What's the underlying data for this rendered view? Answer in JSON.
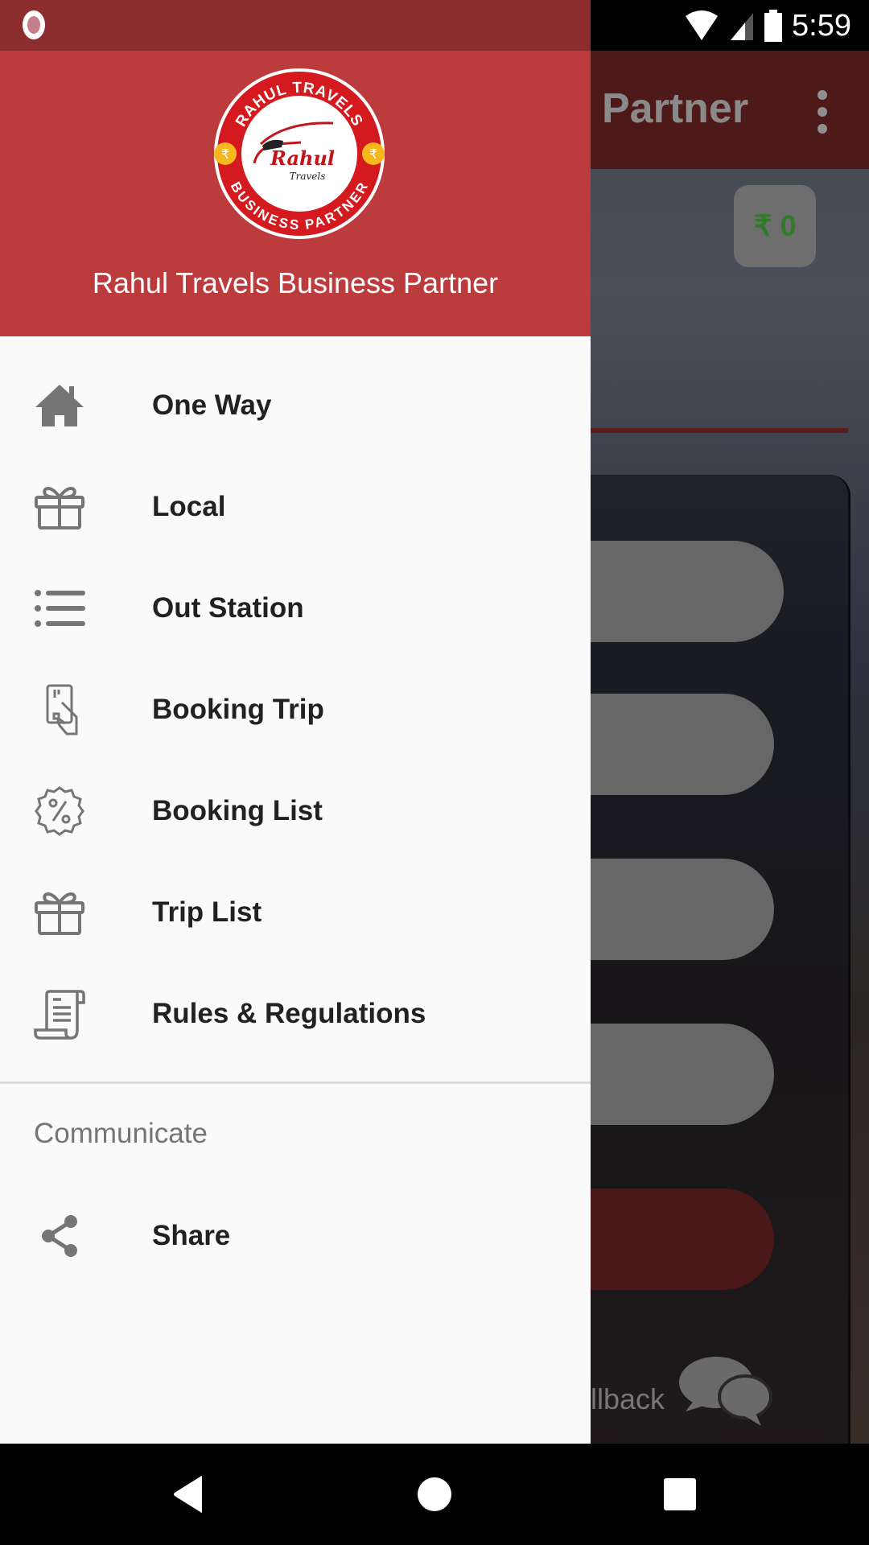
{
  "status_bar": {
    "time": "5:59",
    "icons": [
      "screen-record-icon",
      "wifi-icon",
      "cell-signal-icon",
      "battery-icon"
    ]
  },
  "drawer": {
    "header_title": "Rahul Travels Business Partner",
    "logo": {
      "top_text": "RAHUL TRAVELS",
      "bottom_text": "BUSINESS PARTNER",
      "center_text": "Rahul",
      "center_subtext": "Travels"
    },
    "items": [
      {
        "label": "One Way",
        "icon": "home-icon"
      },
      {
        "label": "Local",
        "icon": "gift-icon"
      },
      {
        "label": "Out Station",
        "icon": "list-icon"
      },
      {
        "label": "Booking Trip",
        "icon": "card-in-hand-icon"
      },
      {
        "label": "Booking List",
        "icon": "discount-badge-icon"
      },
      {
        "label": "Trip List",
        "icon": "gift-icon"
      },
      {
        "label": "Rules & Regulations",
        "icon": "receipt-scroll-icon"
      }
    ],
    "section_label": "Communicate",
    "section_items": [
      {
        "label": "Share",
        "icon": "share-icon"
      }
    ]
  },
  "background_screen": {
    "app_title_partial": "Partner",
    "wallet_balance": "₹ 0",
    "callback_partial": "llback"
  },
  "colors": {
    "drawer_header": "#bc3b3d",
    "status_bar": "#8b2c2f",
    "icon_gray": "#757575",
    "text_dark": "#212121"
  },
  "nav_bar": {
    "buttons": [
      "back",
      "home",
      "recents"
    ]
  }
}
